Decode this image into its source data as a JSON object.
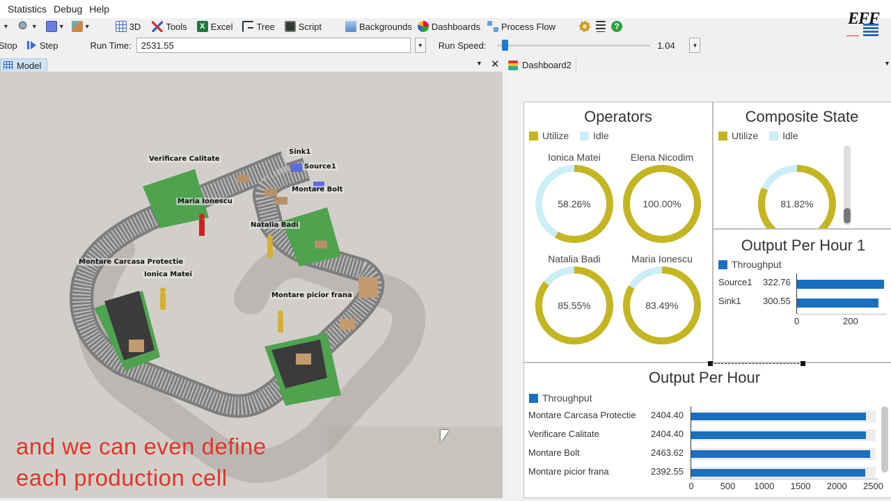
{
  "menu": [
    "Statistics",
    "Debug",
    "Help"
  ],
  "toolbar": {
    "items": [
      "3D",
      "Tools",
      "Excel",
      "Tree",
      "Script",
      "Backgrounds",
      "Dashboards",
      "Process Flow"
    ]
  },
  "logo_text": "EFF",
  "runbar": {
    "stop_label": "Stop",
    "step_label": "Step",
    "run_time_label": "Run Time:",
    "run_time_value": "2531.55",
    "run_speed_label": "Run Speed:",
    "run_speed_value": "1.04",
    "run_speed_fraction": 0.03
  },
  "model_tab": "Model",
  "dashboard_tab": "Dashboard2",
  "model_labels": [
    "Sink1",
    "Source1",
    "Montare Bolt",
    "Verificare Calitate",
    "Maria Ionescu",
    "Natalia Badi",
    "Montare Carcasa Protectie",
    "Ionica Matei",
    "Montare picior frana"
  ],
  "caption_lines": [
    "and we can even define",
    "each production cell"
  ],
  "colors": {
    "utilize": "#c3b622",
    "idle": "#cdeef6",
    "throughput": "#1a6fbf",
    "caption": "#e0352b"
  },
  "operators": {
    "title": "Operators",
    "legend": [
      "Utilize",
      "Idle"
    ],
    "people": [
      {
        "name": "Ionica Matei",
        "value": 58.26,
        "label": "58.26%"
      },
      {
        "name": "Elena Nicodim",
        "value": 100.0,
        "label": "100.00%"
      },
      {
        "name": "Natalia Badi",
        "value": 85.55,
        "label": "85.55%"
      },
      {
        "name": "Maria Ionescu",
        "value": 83.49,
        "label": "83.49%"
      }
    ]
  },
  "composite": {
    "title": "Composite State",
    "legend": [
      "Utilize",
      "Idle"
    ],
    "value": 81.82,
    "label": "81.82%"
  },
  "output1": {
    "title": "Output Per Hour 1",
    "legend": "Throughput",
    "rows": [
      {
        "name": "Source1",
        "value": 322.76,
        "label": "322.76"
      },
      {
        "name": "Sink1",
        "value": 300.55,
        "label": "300.55"
      }
    ],
    "ticks": [
      "0",
      "200"
    ],
    "max": 330
  },
  "output": {
    "title": "Output Per Hour",
    "legend": "Throughput",
    "rows": [
      {
        "name": "Montare Carcasa Protectie",
        "value": 2404.4,
        "label": "2404.40"
      },
      {
        "name": "Verificare Calitate",
        "value": 2404.4,
        "label": "2404.40"
      },
      {
        "name": "Montare Bolt",
        "value": 2463.62,
        "label": "2463.62"
      },
      {
        "name": "Montare picior frana",
        "value": 2392.55,
        "label": "2392.55"
      }
    ],
    "ticks": [
      "0",
      "500",
      "1000",
      "1500",
      "2000",
      "2500"
    ],
    "max": 2500
  }
}
